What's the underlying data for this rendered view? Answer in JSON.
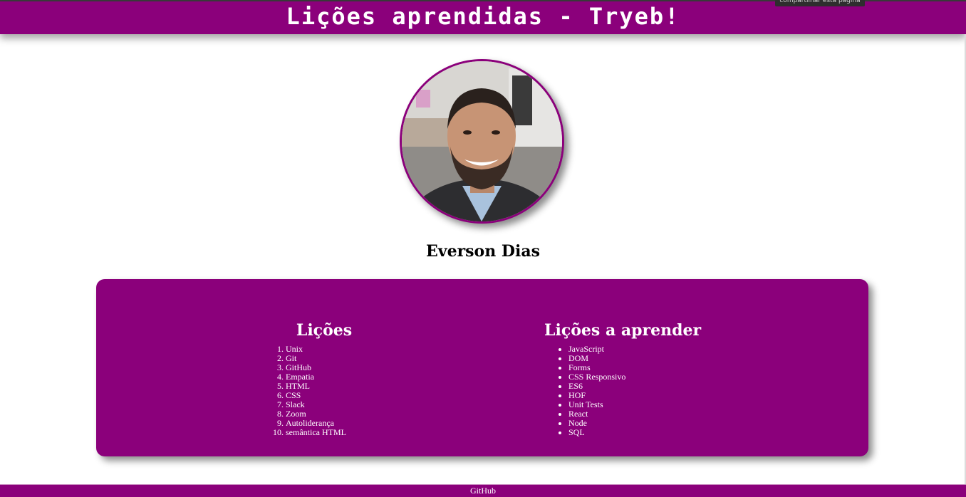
{
  "header": {
    "title": "Lições aprendidas - Tryeb!"
  },
  "tooltip": {
    "text": "compartilhar esta página"
  },
  "profile": {
    "name": "Everson Dias"
  },
  "lessons": {
    "heading": "Lições",
    "items": [
      "Unix",
      "Git",
      "GitHub",
      "Empatia",
      "HTML",
      "CSS",
      "Slack",
      "Zoom",
      "Autoliderança",
      "semântica HTML"
    ]
  },
  "to_learn": {
    "heading": "Lições a aprender",
    "items": [
      "JavaScript",
      "DOM",
      "Forms",
      "CSS Responsivo",
      "ES6",
      "HOF",
      "Unit Tests",
      "React",
      "Node",
      "SQL"
    ]
  },
  "footer": {
    "link": "GitHub"
  },
  "colors": {
    "brand": "#8b007b",
    "background": "#ffffff",
    "text_on_brand": "#ffffff"
  }
}
